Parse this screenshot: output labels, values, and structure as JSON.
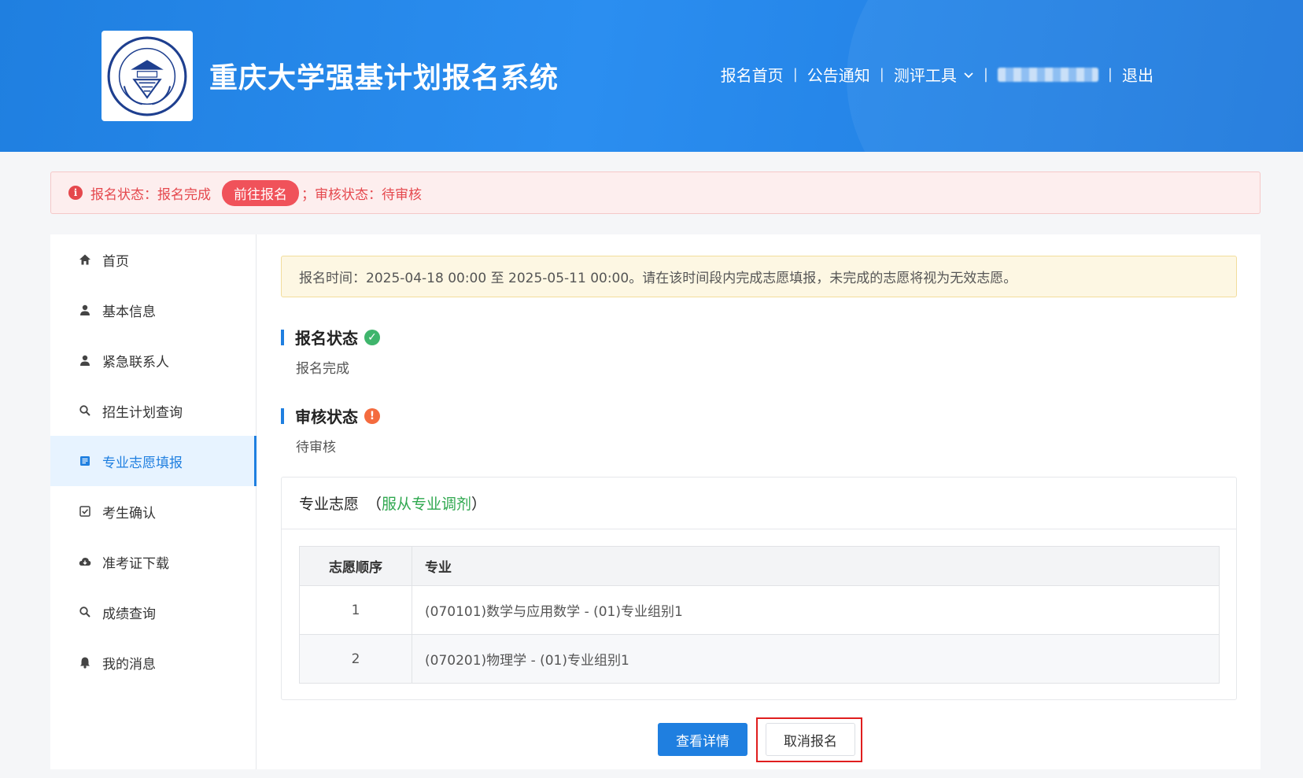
{
  "header": {
    "title": "重庆大学强基计划报名系统",
    "logo_alt": "CHONGQING UNIVERSITY 1929",
    "nav": {
      "home": "报名首页",
      "notice": "公告通知",
      "tools": "测评工具",
      "logout": "退出"
    }
  },
  "alert": {
    "reg_status": "报名状态：报名完成",
    "go_button": "前往报名",
    "review_status": "；审核状态：待审核"
  },
  "sidebar": {
    "items": [
      {
        "label": "首页",
        "icon": "home-icon"
      },
      {
        "label": "基本信息",
        "icon": "user-icon"
      },
      {
        "label": "紧急联系人",
        "icon": "user-icon"
      },
      {
        "label": "招生计划查询",
        "icon": "search-icon"
      },
      {
        "label": "专业志愿填报",
        "icon": "form-icon",
        "active": true
      },
      {
        "label": "考生确认",
        "icon": "checkbox-icon"
      },
      {
        "label": "准考证下载",
        "icon": "cloud-download-icon"
      },
      {
        "label": "成绩查询",
        "icon": "search-icon"
      },
      {
        "label": "我的消息",
        "icon": "bell-icon"
      }
    ]
  },
  "notice": "报名时间：2025-04-18 00:00 至 2025-05-11 00:00。请在该时间段内完成志愿填报，未完成的志愿将视为无效志愿。",
  "registration": {
    "title": "报名状态",
    "value": "报名完成"
  },
  "review": {
    "title": "审核状态",
    "value": "待审核"
  },
  "preferences": {
    "title": "专业志愿",
    "adjust_open": "（",
    "adjust": "服从专业调剂",
    "adjust_close": "）",
    "columns": [
      "志愿顺序",
      "专业"
    ],
    "rows": [
      {
        "order": "1",
        "major": "(070101)数学与应用数学 - (01)专业组别1"
      },
      {
        "order": "2",
        "major": "(070201)物理学 - (01)专业组别1"
      }
    ]
  },
  "actions": {
    "detail": "查看详情",
    "cancel": "取消报名"
  },
  "colors": {
    "primary": "#1f7fe0",
    "danger": "#e5484d",
    "success": "#3fb56c",
    "warning": "#f46b3e"
  }
}
